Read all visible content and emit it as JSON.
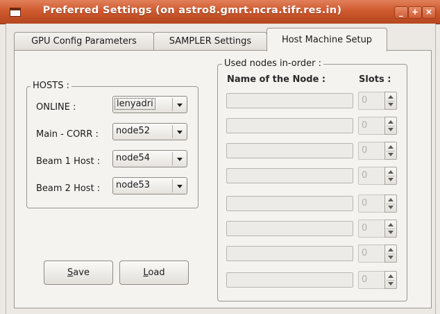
{
  "window": {
    "title": "Preferred Settings (on astro8.gmrt.ncra.tifr.res.in)",
    "minimize": "_",
    "maximize": "+",
    "close": "×"
  },
  "tabs": [
    {
      "label": "GPU Config Parameters"
    },
    {
      "label": "SAMPLER Settings"
    },
    {
      "label": "Host Machine Setup",
      "active": true
    }
  ],
  "hosts": {
    "group_label": "HOSTS :",
    "rows": [
      {
        "label": "ONLINE :",
        "value": "lenyadri"
      },
      {
        "label": "Main - CORR :",
        "value": "node52"
      },
      {
        "label": "Beam 1 Host :",
        "value": "node54"
      },
      {
        "label": "Beam 2 Host :",
        "value": "node53"
      }
    ]
  },
  "nodes": {
    "group_label": "Used nodes in-order :",
    "col_name": "Name of the Node :",
    "col_slots": "Slots :",
    "rows": [
      {
        "name": "",
        "slots": "0"
      },
      {
        "name": "",
        "slots": "0"
      },
      {
        "name": "",
        "slots": "0"
      },
      {
        "name": "",
        "slots": "0"
      },
      {
        "name": "",
        "slots": "0"
      },
      {
        "name": "",
        "slots": "0"
      },
      {
        "name": "",
        "slots": "0"
      },
      {
        "name": "",
        "slots": "0"
      }
    ]
  },
  "buttons": {
    "save_mn": "S",
    "save_rest": "ave",
    "load_mn": "L",
    "load_rest": "oad"
  },
  "colors": {
    "titlebar": "#cf5a2f",
    "window_bg": "#ece9e5"
  }
}
